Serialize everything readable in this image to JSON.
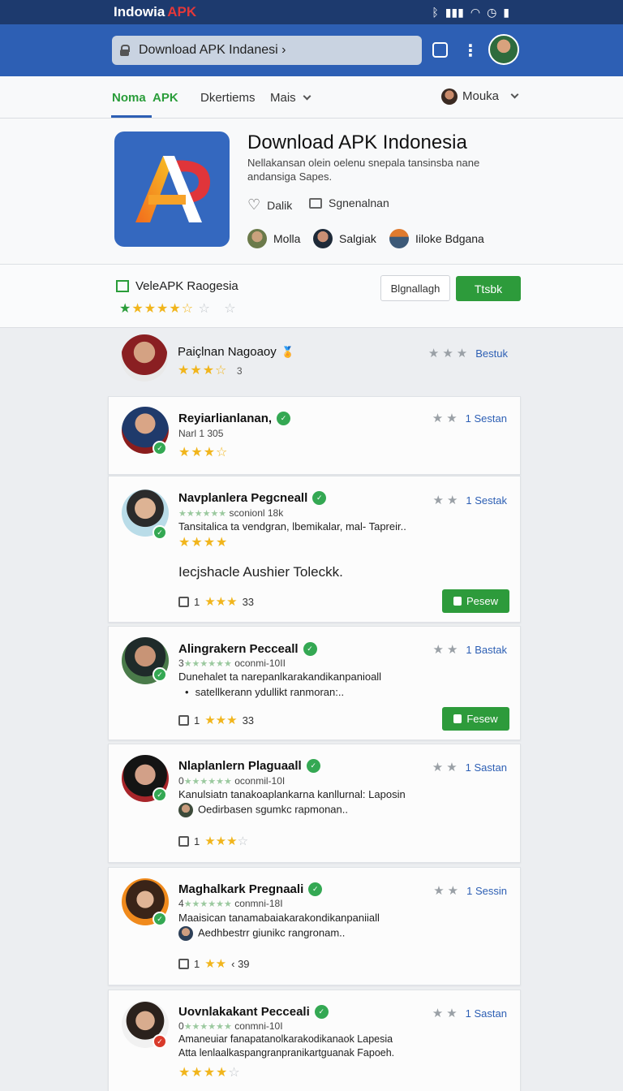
{
  "status": {
    "title": "Indowia",
    "title_accent": "APK",
    "icons": [
      "bluetooth-icon",
      "signal-icon",
      "wifi-icon",
      "battery-icon"
    ]
  },
  "browser": {
    "url": "Download APK Indanesi ›",
    "kebab": "⋮"
  },
  "nav": {
    "home": "Noma",
    "apk": "APK",
    "details": "Dkertiems",
    "more": "Mais",
    "user": "Mouka"
  },
  "app": {
    "title": "Download APK Indonesia",
    "description": "Nellakansan olein oelenu snepala tansinsba nane andansiga Sapes.",
    "like_label": "Dalik",
    "share_label": "Sgnenalnan",
    "developers": [
      "Molla",
      "Salgiak",
      "Iiloke Bdgana"
    ],
    "icon_letters": "AP"
  },
  "rating_bar": {
    "label": "VeleAPK Raogesia",
    "stars": "★★★★☆",
    "secondary_button": "Blgnallagh",
    "primary_button": "Ttsbk"
  },
  "reviews": [
    {
      "name": "Paiçlnan Nagoaoy",
      "stars": "★★★☆",
      "count": "3",
      "right_label": "Bestuk"
    },
    {
      "name": "Reyiarlianlanan,",
      "meta": "Narl 1 305",
      "stars": "★★★☆",
      "right_label": "1 Sestan"
    },
    {
      "name": "Navplanlera Pegcneall",
      "meta": "sconionl 18k",
      "line1": "Tansitalica ta vendgran, lbemikalar, mal- Tapreir..",
      "stars": "★★★★",
      "extra_text": "Iecjshacle Aushier Toleckk.",
      "foot_count": "1",
      "foot_num": "33",
      "button": "Pesew",
      "right_label": "1 Sestak"
    },
    {
      "name": "Alingrakern Pecceall",
      "meta_prefix": "3",
      "meta": "oconmi-10II",
      "line1": "Dunehalet ta narepanlkarakandikanpanioall",
      "line2": "satellkerann ydullikt ranmoran:..",
      "foot_count": "1",
      "foot_num": "33",
      "button": "Fesew",
      "right_label": "1 Bastak"
    },
    {
      "name": "Nlaplanlern Plaguaall",
      "meta_prefix": "0",
      "meta": "oconmil-10I",
      "line1": "Kanulsiatn tanakoaplankarna kanllurnal: Laposin",
      "line2": "Oedirbasen sgumkc rapmonan..",
      "foot_count": "1",
      "right_label": "1 Sastan"
    },
    {
      "name": "Maghalkark Pregnaali",
      "meta_prefix": "4",
      "meta": "conmni-18I",
      "line1": "Maaisican tanamabaiakarakondikanpaniiall",
      "line2": "Aedhbestrr giunikc rangronam..",
      "foot_count": "1",
      "foot_num": "‹ 39",
      "right_label": "1 Sessin"
    },
    {
      "name": "Uovnlakakant Pecceali",
      "meta_prefix": "0",
      "meta": "conmni-10I",
      "line1": "Amaneuiar fanapatanolkarakodikanaok Lapesia",
      "line2": "Atta lenlaalkaspangranpranikartguanak Fapoeh.",
      "stars": "★★★★",
      "right_label": "1 Sastan"
    }
  ],
  "colors": {
    "status_bar": "#1d3a6e",
    "browser_bar": "#2d5fb4",
    "accent_green": "#2d9b3b",
    "star": "#f1b51c"
  }
}
